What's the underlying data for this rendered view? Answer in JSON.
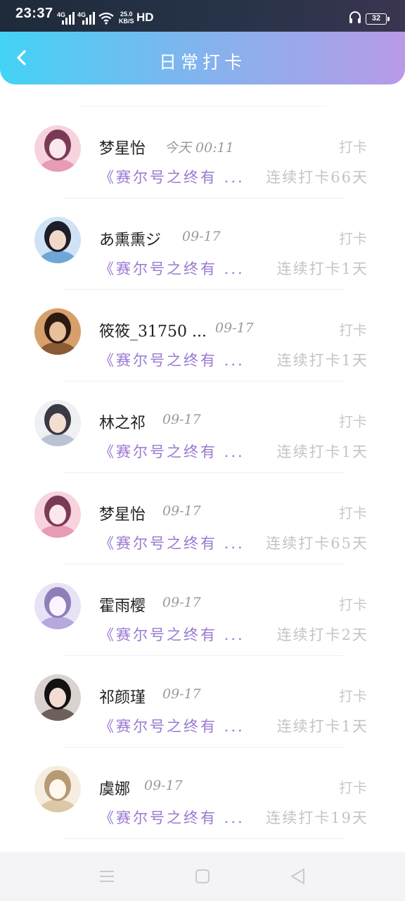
{
  "status_bar": {
    "time": "23:37",
    "network1": "4G",
    "network2": "4G",
    "speed_value": "25.0",
    "speed_unit": "KB/S",
    "hd": "HD",
    "battery": "32"
  },
  "header": {
    "title": "日常打卡"
  },
  "colors": {
    "header_gradient_start": "#43d3f5",
    "header_gradient_end": "#b89ae8",
    "course_text": "#9b79d2",
    "muted_text": "#c4c4c4"
  },
  "entries": [
    {
      "name": "梦星怡",
      "date": "今天 00:11",
      "action": "打卡",
      "course": "《赛尔号之终有 ...",
      "streak": "连续打卡66天",
      "avatar": "pink-anime-avatar"
    },
    {
      "name": "あ熏熏ジ",
      "date": "09-17",
      "action": "打卡",
      "course": "《赛尔号之终有 ...",
      "streak": "连续打卡1天",
      "avatar": "photo-avatar-blue"
    },
    {
      "name": "筱筱_31750 ...",
      "date": "09-17",
      "action": "打卡",
      "course": "《赛尔号之终有 ...",
      "streak": "连续打卡1天",
      "avatar": "photo-avatar-brown"
    },
    {
      "name": "林之祁",
      "date": "09-17",
      "action": "打卡",
      "course": "《赛尔号之终有 ...",
      "streak": "连续打卡1天",
      "avatar": "photo-avatar-light"
    },
    {
      "name": "梦星怡",
      "date": "09-17",
      "action": "打卡",
      "course": "《赛尔号之终有 ...",
      "streak": "连续打卡65天",
      "avatar": "pink-anime-avatar"
    },
    {
      "name": "霍雨樱",
      "date": "09-17",
      "action": "打卡",
      "course": "《赛尔号之终有 ...",
      "streak": "连续打卡2天",
      "avatar": "anime-avatar-lilac"
    },
    {
      "name": "祁颜瑾",
      "date": "09-17",
      "action": "打卡",
      "course": "《赛尔号之终有 ...",
      "streak": "连续打卡1天",
      "avatar": "photo-avatar-dark"
    },
    {
      "name": "虞娜",
      "date": "09-17",
      "action": "打卡",
      "course": "《赛尔号之终有 ...",
      "streak": "连续打卡19天",
      "avatar": "anime-avatar-cream"
    }
  ],
  "nav": {
    "menu_icon": "menu-icon",
    "home_icon": "home-icon",
    "back_icon": "back-triangle-icon"
  }
}
